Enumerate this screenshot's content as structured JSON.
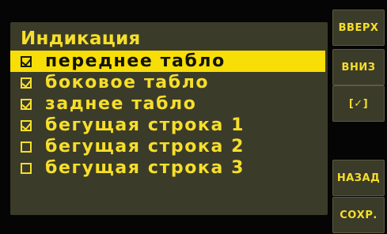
{
  "screen": {
    "title": "Индикация",
    "items": [
      {
        "label": "переднее табло",
        "checked": true,
        "selected": true
      },
      {
        "label": "боковое табло",
        "checked": true,
        "selected": false
      },
      {
        "label": "заднее табло",
        "checked": true,
        "selected": false
      },
      {
        "label": "бегущая строка 1",
        "checked": true,
        "selected": false
      },
      {
        "label": "бегущая строка 2",
        "checked": false,
        "selected": false
      },
      {
        "label": "бегущая строка 3",
        "checked": false,
        "selected": false
      }
    ]
  },
  "buttons": {
    "up": "ВВЕРХ",
    "down": "ВНИЗ",
    "toggle": "[✓]",
    "back": "НАЗАД",
    "save": "СОХР."
  },
  "colors": {
    "background": "#050505",
    "panel": "#3b3b2a",
    "accent": "#f6df2a",
    "highlight": "#f8de07"
  }
}
